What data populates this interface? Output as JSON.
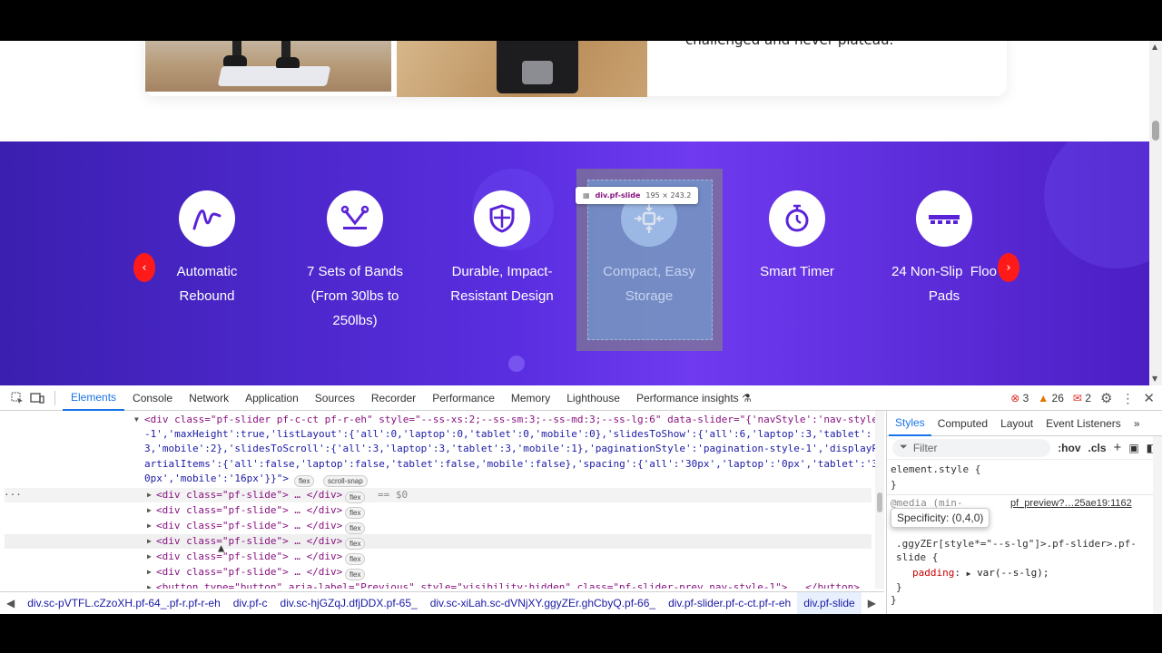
{
  "page": {
    "quote_text": "challenged and never plateau.",
    "features": [
      {
        "icon": "rebound-curve-icon",
        "label_line1": "Automatic",
        "label_line2": "Rebound",
        "label_line3": ""
      },
      {
        "icon": "bands-icon",
        "label_line1": "7 Sets of Bands",
        "label_line2": "(From 30lbs to",
        "label_line3": "250lbs)"
      },
      {
        "icon": "shield-icon",
        "label_line1": "Durable, Impact-",
        "label_line2": "Resistant Design",
        "label_line3": ""
      },
      {
        "icon": "compact-storage-icon",
        "label_line1": "Compact, Easy",
        "label_line2": "Storage",
        "label_line3": ""
      },
      {
        "icon": "timer-icon",
        "label_line1": "Smart Timer",
        "label_line2": "",
        "label_line3": ""
      },
      {
        "icon": "non-slip-pads-icon",
        "label_line1": "24 Non-Slip  Floo",
        "label_line2": "Pads",
        "label_line3": ""
      }
    ],
    "prev_arrow": "‹",
    "next_arrow": "›",
    "inspect_tooltip": {
      "selector": "div.pf-slide",
      "dims": "195 × 243.2"
    }
  },
  "devtools": {
    "tabs": [
      "Elements",
      "Console",
      "Network",
      "Application",
      "Sources",
      "Recorder",
      "Performance",
      "Memory",
      "Lighthouse",
      "Performance insights ⚗"
    ],
    "active_tab": "Elements",
    "error_count": "3",
    "warning_count": "26",
    "issue_count": "2",
    "dom": {
      "slider_line1": "<div class=\"pf-slider pf-c-ct pf-r-eh\" style=\"--ss-xs:2;--ss-sm:3;--ss-md:3;--ss-lg:6\" data-slider=\"{'navStyle':'nav-style",
      "slider_line2": "-1','maxHeight':true,'listLayout':{'all':0,'laptop':0,'tablet':0,'mobile':0},'slidesToShow':{'all':6,'laptop':3,'tablet':",
      "slider_line3": "3,'mobile':2},'slidesToScroll':{'all':3,'laptop':3,'tablet':3,'mobile':1},'paginationStyle':'pagination-style-1','displayP",
      "slider_line4": "artialItems':{'all':false,'laptop':false,'tablet':false,'mobile':false},'spacing':{'all':'30px','laptop':'0px','tablet':'3",
      "slider_line5": "0px','mobile':'16px'}}\">",
      "badge_flex": "flex",
      "badge_snap": "scroll-snap",
      "slide_line": "<div class=\"pf-slide\"> … </div>",
      "selected_marker": "== $0",
      "button_line": "<button type=\"button\" aria-label=\"Previous\" style=\"visibility:hidden\" class=\"pf-slider-prev nav-style-1\"> … </button>"
    },
    "styles": {
      "tabs": [
        "Styles",
        "Computed",
        "Layout",
        "Event Listeners",
        "»"
      ],
      "active_tab": "Styles",
      "filter_placeholder": "Filter",
      "hov": ":hov",
      "cls": ".cls",
      "element_style_open": "element.style {",
      "element_style_close": "}",
      "media_text": "@media (min-",
      "source_link": "pf_preview?…25ae19:1162",
      "specificity": "Specificity: (0,4,0)",
      "rule_selector1": ".ggyZEr[style*=\"--s-lg\"]>.pf-slider>.pf-",
      "rule_selector2": "slide {",
      "rule_prop": "padding",
      "rule_value": "var(--s-lg);",
      "rule_close": "}",
      "outer_close": "}"
    },
    "breadcrumbs": [
      "div.sc-pVTFL.cZzoXH.pf-64_.pf-r.pf-r-eh",
      "div.pf-c",
      "div.sc-hjGZqJ.dfjDDX.pf-65_",
      "div.sc-xiLah.sc-dVNjXY.ggyZEr.ghCbyQ.pf-66_",
      "div.pf-slider.pf-c-ct.pf-r-eh",
      "div.pf-slide"
    ]
  }
}
